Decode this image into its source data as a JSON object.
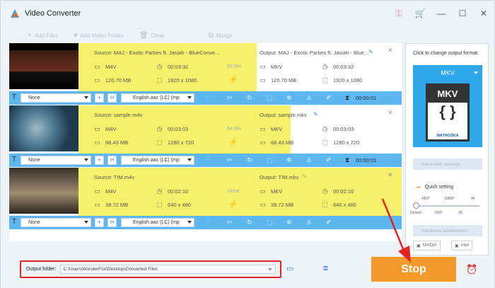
{
  "window": {
    "title": "Video Converter"
  },
  "toolbar": {
    "add_files": "Add Files",
    "add_video_folder": "Add Video Folder",
    "clear": "Clear",
    "merge": "Merge"
  },
  "items": [
    {
      "thumb_color": "#1a1a1a",
      "source": {
        "name": "Source: MAJ - Exotic Parties ft. Jasiah - BlueConve...",
        "format": "M4V",
        "duration": "00:03:32",
        "size": "120.70 MB",
        "resolution": "1920 x 1080",
        "progress": "55.3%"
      },
      "output": {
        "name": "Output: MAJ - Exotic Parties ft. Jasiah - Blue...",
        "format": "MKV",
        "duration": "00:03:32",
        "size": "120.70 MB",
        "resolution": "1920 x 1080"
      },
      "bar": {
        "subtitle": "None",
        "audio": "English aac (LC) (mp",
        "duration": "00:00:01"
      }
    },
    {
      "thumb_color": "#3d6b86",
      "source": {
        "name": "Source: sample.m4v",
        "format": "M4V",
        "duration": "00:03:03",
        "size": "68.43 MB",
        "resolution": "1280 x 720",
        "progress": "64.6%"
      },
      "output": {
        "name": "Output: sample.mkv",
        "format": "MKV",
        "duration": "00:03:03",
        "size": "68.43 MB",
        "resolution": "1280 x 720"
      },
      "bar": {
        "subtitle": "None",
        "audio": "English aac (LC) (mp",
        "duration": "00:00:01"
      }
    },
    {
      "thumb_color": "#6b5a44",
      "source": {
        "name": "Source: TIM.m4v",
        "format": "M4V",
        "duration": "00:02:10",
        "size": "39.72 MB",
        "resolution": "640 x 480",
        "progress": "Done"
      },
      "output": {
        "name": "Output: TIM.mkv",
        "format": "MKV",
        "duration": "00:02:10",
        "size": "39.72 MB",
        "resolution": "640 x 480"
      },
      "bar": {
        "subtitle": "None",
        "audio": "English aac (LC) (mp",
        "duration": "00:00:01"
      }
    }
  ],
  "right_panel": {
    "caption": "Click to change output format:",
    "format": "MKV",
    "logo_text": "MKV",
    "logo_sub": "MATROŠKA",
    "parameter_settings": "Parameter settings",
    "quick_setting": "Quick setting",
    "ticks_top": [
      "480P",
      "1080P",
      "4K"
    ],
    "ticks_bottom": [
      "Default",
      "720P",
      "2K"
    ],
    "hw_accel": "Hardware acceleration",
    "nvidia": "NVIDIA",
    "intel": "Intel"
  },
  "bottom": {
    "output_folder_label": "Output folder:",
    "output_folder_value": "C:\\Users\\WonderFox\\Desktop\\Converted Files",
    "stop": "Stop"
  },
  "colors": {
    "accent_blue": "#5eb7f0",
    "highlight": "#f7f06a",
    "stop": "#f49a2a",
    "red_marker": "#e42323"
  }
}
